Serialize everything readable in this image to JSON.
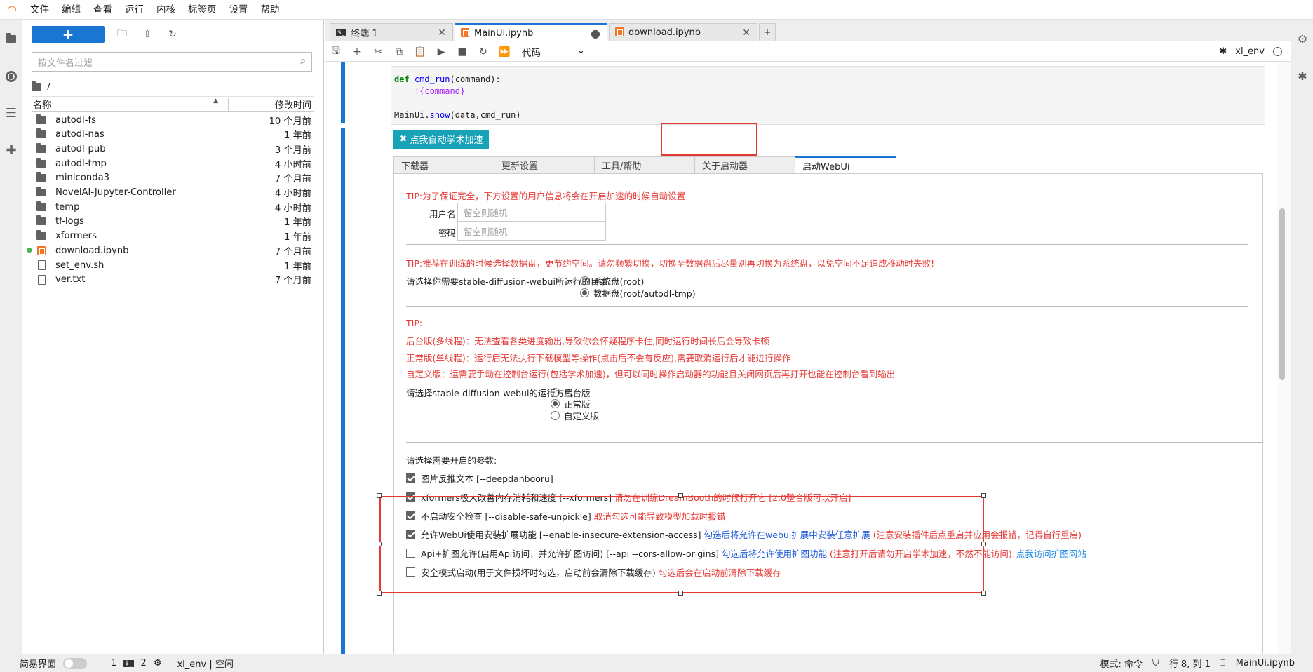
{
  "menu": [
    "文件",
    "编辑",
    "查看",
    "运行",
    "内核",
    "标签页",
    "设置",
    "帮助"
  ],
  "filebrowser": {
    "new_label": "+",
    "filter_placeholder": "按文件名过滤",
    "breadcrumb": "/",
    "col_name": "名称",
    "col_modified": "修改时间",
    "files": [
      {
        "name": "autodl-fs",
        "modified": "10 个月前",
        "type": "folder"
      },
      {
        "name": "autodl-nas",
        "modified": "1 年前",
        "type": "folder"
      },
      {
        "name": "autodl-pub",
        "modified": "3 个月前",
        "type": "folder"
      },
      {
        "name": "autodl-tmp",
        "modified": "4 小时前",
        "type": "folder"
      },
      {
        "name": "miniconda3",
        "modified": "7 个月前",
        "type": "folder"
      },
      {
        "name": "NovelAI-Jupyter-Controller",
        "modified": "4 小时前",
        "type": "folder"
      },
      {
        "name": "temp",
        "modified": "4 小时前",
        "type": "folder"
      },
      {
        "name": "tf-logs",
        "modified": "1 年前",
        "type": "folder"
      },
      {
        "name": "xformers",
        "modified": "1 年前",
        "type": "folder"
      },
      {
        "name": "download.ipynb",
        "modified": "7 个月前",
        "type": "notebook"
      },
      {
        "name": "set_env.sh",
        "modified": "1 年前",
        "type": "file"
      },
      {
        "name": "ver.txt",
        "modified": "7 个月前",
        "type": "file"
      }
    ]
  },
  "tabs": [
    {
      "label": "终端 1",
      "icon": "terminal-icon"
    },
    {
      "label": "MainUi.ipynb",
      "icon": "notebook-icon",
      "active": true
    },
    {
      "label": "download.ipynb",
      "icon": "notebook-icon"
    }
  ],
  "toolbar": {
    "cell_type": "代码",
    "kernel": "xl_env"
  },
  "code": {
    "line1_kw": "def",
    "line1_fn": "cmd_run",
    "line1_rest": "(command):",
    "line2": "    !{command}",
    "line3_a": "MainUi.",
    "line3_fn": "show",
    "line3_b": "(data,cmd_run)"
  },
  "accel_button": "点我自动学术加速",
  "subtabs": [
    "下载器",
    "更新设置",
    "工具/帮助",
    "关于启动器",
    "启动WebUi"
  ],
  "webui": {
    "tip1": "TIP:为了保证完全，下方设置的用户信息将会在开启加速的时候自动设置",
    "username_label": "用户名:",
    "username_placeholder": "留空则随机",
    "password_label": "密码:",
    "password_placeholder": "留空则随机",
    "tip2": "TIP:推荐在训练的时候选择数据盘，更节约空间。请勿频繁切换，切换至数据盘后尽量别再切换为系统盘，以免空间不足造成移动时失败!",
    "dir_label": "请选择你需要stable-diffusion-webui所运行的目录:",
    "dir_opt1": "系统盘(root)",
    "dir_opt2": "数据盘(root/autodl-tmp)",
    "tip3": "TIP:",
    "tip3a": "后台版(多线程)：无法查看各类进度输出,导致你会怀疑程序卡住,同时运行时间长后会导致卡顿",
    "tip3b": "正常版(单线程)：运行后无法执行下载模型等操作(点击后不会有反应),需要取消运行后才能进行操作",
    "tip3c": "自定义版：运需要手动在控制台运行(包括学术加速)，但可以同时操作启动器的功能且关闭网页后再打开也能在控制台看到输出",
    "mode_label": "请选择stable-diffusion-webui的运行方式:",
    "mode_opt1": "后台版",
    "mode_opt2": "正常版",
    "mode_opt3": "自定义版",
    "params_label": "请选择需要开启的参数:",
    "p1": "图片反推文本 [--deepdanbooru]",
    "p2": "xformers极大改善内存消耗和速度 [--xformers]",
    "p2_red": "请勿在训练DreamBooth的时候打开它 [2.0整合版可以开启]",
    "p3": "不启动安全检查 [--disable-safe-unpickle]",
    "p3_red": "取消勾选可能导致模型加载时报错",
    "p4": "允许WebUi使用安装扩展功能 [--enable-insecure-extension-access]",
    "p4_blue": "勾选后将允许在webui扩展中安装任意扩展",
    "p4_red": "(注意安装插件后点重启并应用会报错，记得自行重启)",
    "p5": "Api+扩图允许(启用Api访问，并允许扩图访问) [--api --cors-allow-origins]",
    "p5_blue": "勾选后将允许使用扩图功能",
    "p5_red": "(注意打开后请勿开启学术加速，不然不能访问)",
    "p5_link": "点我访问扩图网站",
    "p6": "安全模式启动(用于文件损坏时勾选，启动前会清除下载缓存)",
    "p6_red": "勾选后会在启动前清除下载缓存"
  },
  "status": {
    "simple_label": "简易界面",
    "count1": "1",
    "count2": "2",
    "kernel": "xl_env | 空闲",
    "mode": "模式: 命令",
    "pos": "行 8, 列 1",
    "file": "MainUi.ipynb"
  }
}
